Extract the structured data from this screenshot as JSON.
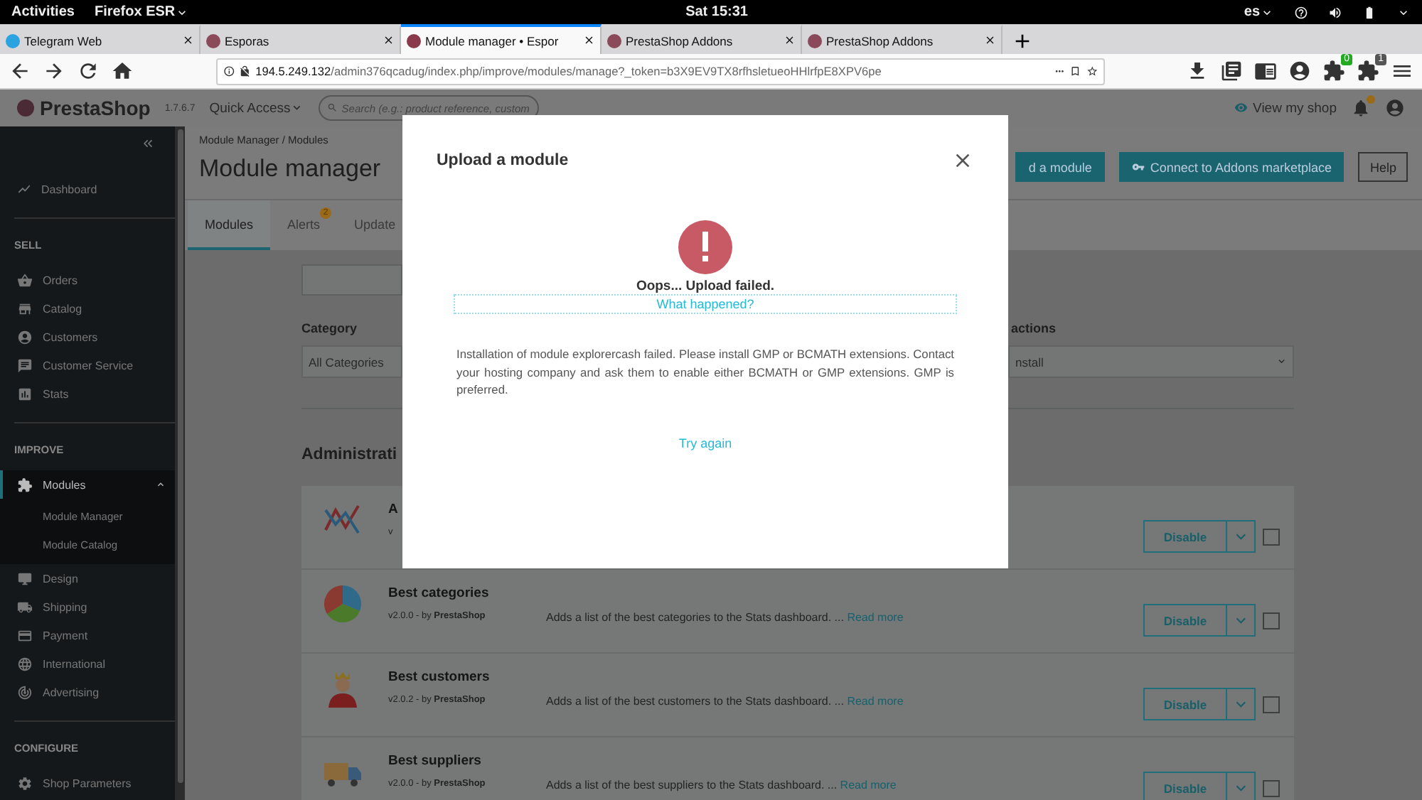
{
  "system_bar": {
    "activities": "Activities",
    "app": "Firefox ESR",
    "clock": "Sat 15:31",
    "language": "es"
  },
  "browser": {
    "tabs": [
      {
        "title": "Telegram Web",
        "selected": false
      },
      {
        "title": "Esporas",
        "selected": false
      },
      {
        "title": "Module manager • Espor",
        "selected": true
      },
      {
        "title": "PrestaShop Addons",
        "selected": false
      },
      {
        "title": "PrestaShop Addons",
        "selected": false
      }
    ],
    "url": {
      "host": "194.5.249.132",
      "path": "/admin376qcadug/index.php/improve/modules/manage?_token=b3X9EV9TX8rfhsletueoHHlrfpE8XPV6pe"
    },
    "extension_badges": [
      "0",
      "1"
    ]
  },
  "app_header": {
    "logo": "PrestaShop",
    "version": "1.7.6.7",
    "quick_access": "Quick Access",
    "search": {
      "placeholder": "Search (e.g.: product reference, custom"
    },
    "view_shop": "View my shop"
  },
  "sidebar": {
    "dashboard": "Dashboard",
    "sections": [
      {
        "title": "SELL",
        "items": [
          {
            "label": "Orders",
            "selected": false
          },
          {
            "label": "Catalog",
            "selected": false
          },
          {
            "label": "Customers",
            "selected": false
          },
          {
            "label": "Customer Service",
            "selected": false
          },
          {
            "label": "Stats",
            "selected": false
          }
        ]
      },
      {
        "title": "IMPROVE",
        "items": [
          {
            "label": "Modules",
            "selected": true,
            "children": [
              {
                "label": "Module Manager"
              },
              {
                "label": "Module Catalog"
              }
            ]
          },
          {
            "label": "Design",
            "selected": false
          },
          {
            "label": "Shipping",
            "selected": false
          },
          {
            "label": "Payment",
            "selected": false
          },
          {
            "label": "International",
            "selected": false
          },
          {
            "label": "Advertising",
            "selected": false
          }
        ]
      },
      {
        "title": "CONFIGURE",
        "items": [
          {
            "label": "Shop Parameters",
            "selected": false
          }
        ]
      }
    ]
  },
  "page_header": {
    "breadcrumb": "Module Manager / Modules",
    "title": "Module manager",
    "buttons": [
      {
        "label": "d a module",
        "kind": "primary"
      },
      {
        "label": "Connect to Addons marketplace",
        "kind": "primary"
      },
      {
        "label": "Help",
        "kind": "outline"
      }
    ],
    "tabs": [
      {
        "label": "Modules",
        "selected": true
      },
      {
        "label": "Alerts",
        "selected": false,
        "badge": "2"
      },
      {
        "label": "Update",
        "selected": false
      }
    ]
  },
  "filters": {
    "category": {
      "label": "Category",
      "value": "All Categories"
    },
    "bulk": {
      "label": "actions",
      "value": "nstall"
    }
  },
  "section_title": "Administrati",
  "modules": [
    {
      "name": "A",
      "version": "v",
      "action": "Disable",
      "checked": false
    },
    {
      "name": "Best categories",
      "version": "v2.0.0 - by **PrestaShop**",
      "description": "Adds a list of the best categories to the Stats dashboard. ...",
      "link": "Read more",
      "action": "Disable",
      "checked": false
    },
    {
      "name": "Best customers",
      "version": "v2.0.2 - by **PrestaShop**",
      "description": "Adds a list of the best customers to the Stats dashboard. ...",
      "link": "Read more",
      "action": "Disable",
      "checked": false
    },
    {
      "name": "Best suppliers",
      "version": "v2.0.0 - by **PrestaShop**",
      "description": "Adds a list of the best suppliers to the Stats dashboard. ...",
      "link": "Read more",
      "action": "Disable",
      "checked": false
    }
  ],
  "modal": {
    "title": "Upload a module",
    "status": "Oops... Upload failed.",
    "details_link": "What happened?",
    "message": "Installation of module explorercash failed. Please install GMP or BCMATH extensions. Contact your hosting company and ask them to enable either BCMATH or GMP extensions. GMP is preferred.",
    "retry": "Try again"
  }
}
